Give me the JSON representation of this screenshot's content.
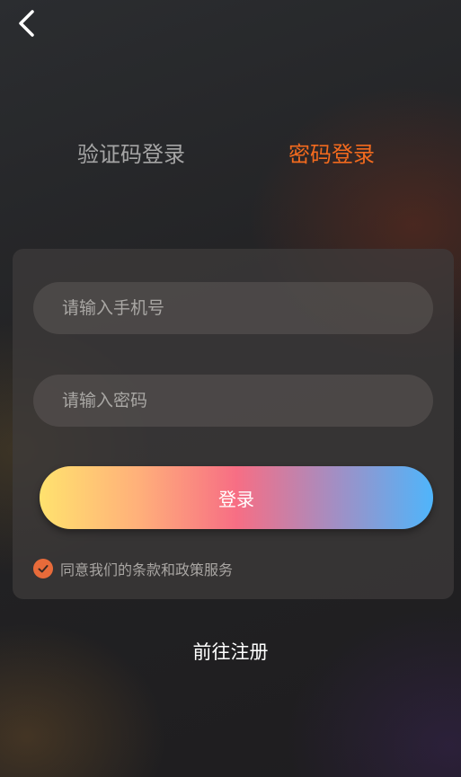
{
  "header": {
    "back_icon": "chevron-left-icon"
  },
  "tabs": [
    {
      "label": "验证码登录",
      "active": false
    },
    {
      "label": "密码登录",
      "active": true
    }
  ],
  "form": {
    "phone_placeholder": "请输入手机号",
    "phone_value": "",
    "password_placeholder": "请输入密码",
    "password_value": "",
    "login_label": "登录",
    "agree_checked": true,
    "agree_label": "同意我们的条款和政策服务"
  },
  "footer": {
    "register_label": "前往注册"
  },
  "colors": {
    "accent": "#f26a1e",
    "check": "#e86b3a",
    "inactive_tab": "#a5a5a5"
  }
}
